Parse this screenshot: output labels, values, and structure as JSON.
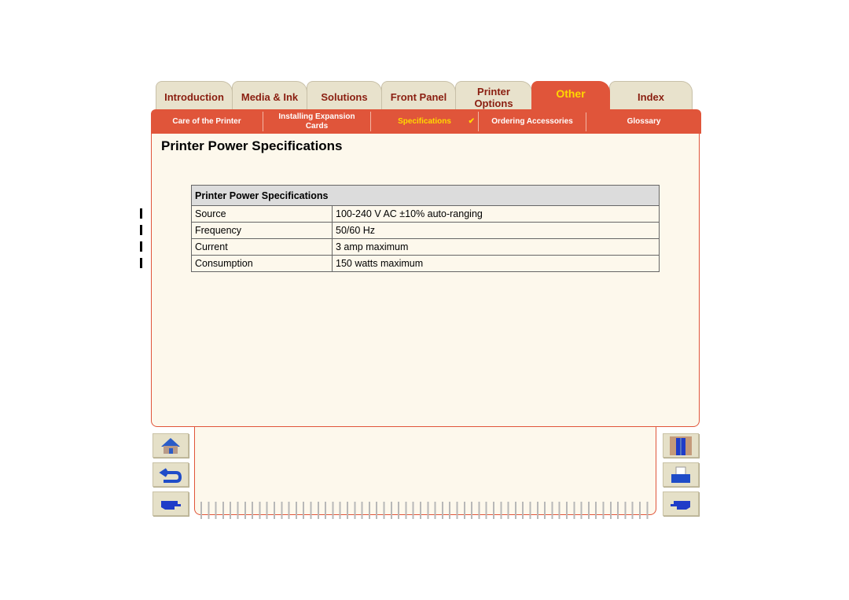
{
  "tabs": [
    {
      "label": "Introduction"
    },
    {
      "label": "Media & Ink"
    },
    {
      "label": "Solutions"
    },
    {
      "label": "Front Panel"
    },
    {
      "label": "Printer Options"
    },
    {
      "label": "Other",
      "active": true
    },
    {
      "label": "Index"
    }
  ],
  "subnav": [
    {
      "label": "Care of the Printer"
    },
    {
      "label": "Installing Expansion Cards"
    },
    {
      "label": "Specifications",
      "active": true,
      "check": "✔"
    },
    {
      "label": "Ordering Accessories"
    },
    {
      "label": "Glossary"
    }
  ],
  "page_title": "Printer Power Specifications",
  "table": {
    "header": "Printer Power Specifications",
    "rows": [
      [
        "Source",
        "100-240 V AC ±10% auto-ranging"
      ],
      [
        "Frequency",
        "50/60 Hz"
      ],
      [
        "Current",
        "3 amp maximum"
      ],
      [
        "Consumption",
        "150 watts maximum"
      ]
    ]
  },
  "colors": {
    "accent": "#e0553a",
    "active_text": "#ffd800",
    "background": "#fdf8ec"
  },
  "buttons": {
    "left": [
      "home-icon",
      "back-icon",
      "next-page-icon"
    ],
    "right": [
      "exit-door-icon",
      "print-icon",
      "previous-page-icon"
    ]
  }
}
